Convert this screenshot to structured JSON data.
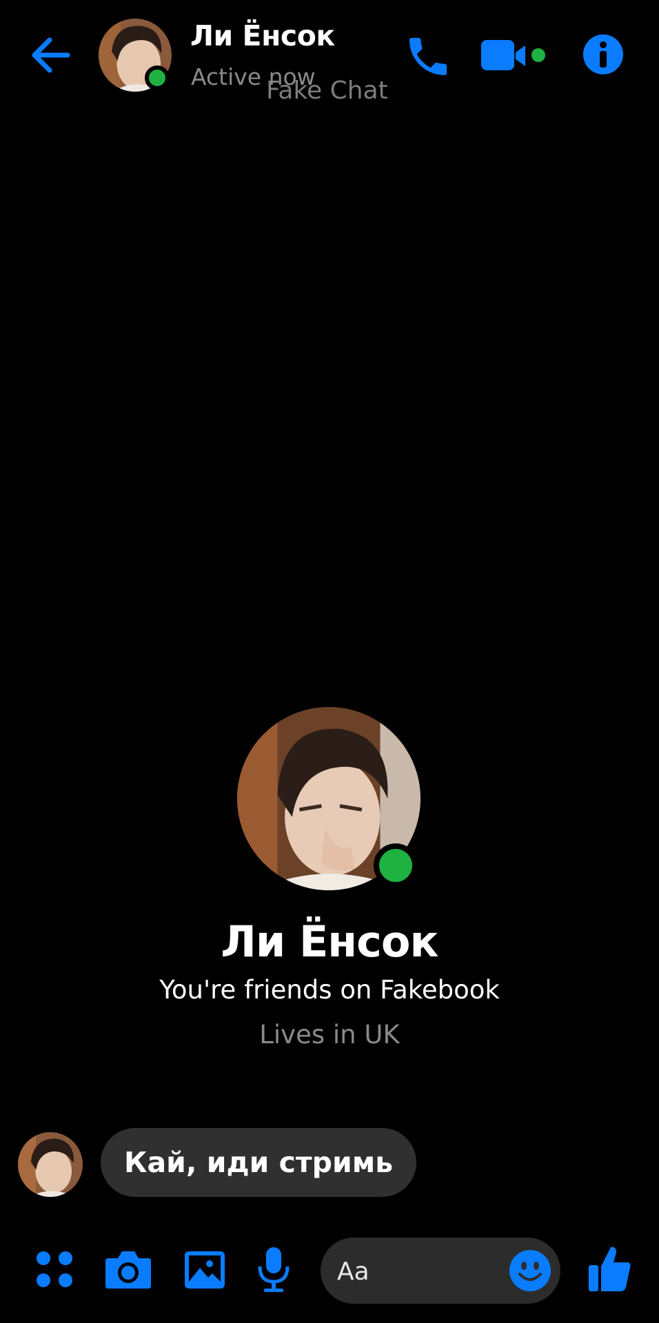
{
  "colors": {
    "background": "#000000",
    "accent": "#0a7cff",
    "online": "#1fb141",
    "bubble": "#303030",
    "muted_text": "#8a8a8a"
  },
  "header": {
    "contact_name": "Ли Ёнсок",
    "status": "Active now",
    "watermark": "Fake Chat",
    "icons": [
      "back-arrow-icon",
      "phone-icon",
      "video-camera-icon",
      "info-icon"
    ]
  },
  "profile": {
    "name": "Ли Ёнсок",
    "friendship": "You're friends on Fakebook",
    "location": "Lives in UK"
  },
  "messages": [
    {
      "sender": "contact",
      "text": "Кай, иди стримь"
    }
  ],
  "composer": {
    "placeholder": "Aa",
    "icons": [
      "apps-icon",
      "camera-icon",
      "gallery-icon",
      "microphone-icon",
      "emoji-icon",
      "thumbs-up-icon"
    ]
  }
}
